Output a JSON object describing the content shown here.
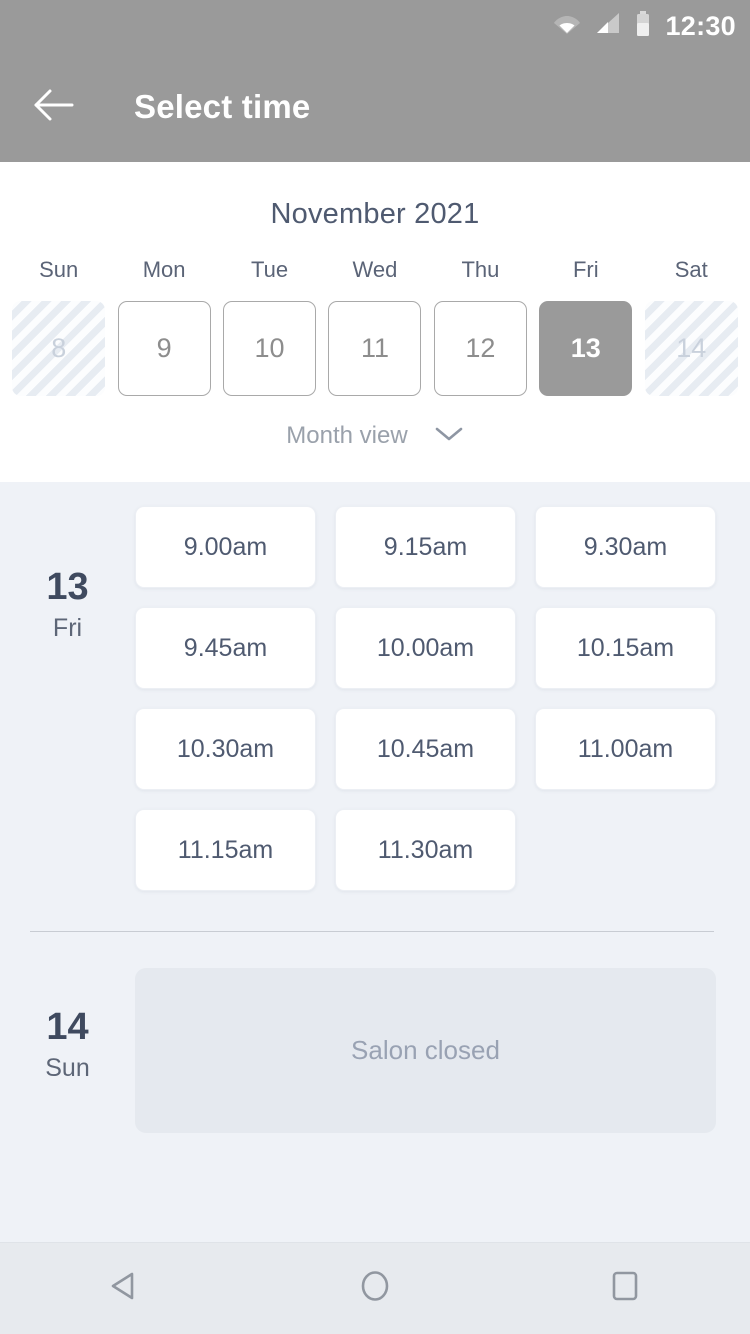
{
  "status_bar": {
    "time": "12:30",
    "icons": [
      "wifi-icon",
      "cellular-signal-icon",
      "battery-icon"
    ]
  },
  "app_bar": {
    "back_icon": "arrow-left-icon",
    "title": "Select time",
    "background_color": "#9a9a9a",
    "title_color": "#ffffff"
  },
  "calendar": {
    "month_label": "November 2021",
    "weekdays": [
      "Sun",
      "Mon",
      "Tue",
      "Wed",
      "Thu",
      "Fri",
      "Sat"
    ],
    "dates": [
      {
        "day": "8",
        "state": "disabled"
      },
      {
        "day": "9",
        "state": "enabled"
      },
      {
        "day": "10",
        "state": "enabled"
      },
      {
        "day": "11",
        "state": "enabled"
      },
      {
        "day": "12",
        "state": "enabled"
      },
      {
        "day": "13",
        "state": "selected"
      },
      {
        "day": "14",
        "state": "disabled"
      }
    ],
    "view_toggle": {
      "label": "Month view",
      "icon": "chevron-down-icon"
    },
    "selected_color": "#9a9a9a",
    "text_color": "#4f5a70"
  },
  "schedule": {
    "days": [
      {
        "date_number": "13",
        "weekday": "Fri",
        "closed": false,
        "closed_label": "",
        "slots": [
          "9.00am",
          "9.15am",
          "9.30am",
          "9.45am",
          "10.00am",
          "10.15am",
          "10.30am",
          "10.45am",
          "11.00am",
          "11.15am",
          "11.30am"
        ]
      },
      {
        "date_number": "14",
        "weekday": "Sun",
        "closed": true,
        "closed_label": "Salon closed",
        "slots": []
      }
    ],
    "background_color": "#eff2f7",
    "slot_color": "#ffffff"
  },
  "nav_bar": {
    "buttons": [
      {
        "name": "back-nav-button",
        "icon": "triangle-left-icon"
      },
      {
        "name": "home-nav-button",
        "icon": "circle-icon"
      },
      {
        "name": "recents-nav-button",
        "icon": "square-icon"
      }
    ],
    "background_color": "#e7eaee"
  }
}
